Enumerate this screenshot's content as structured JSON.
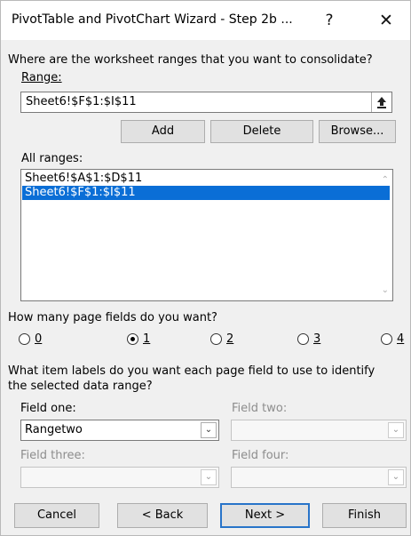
{
  "window": {
    "title": "PivotTable and PivotChart Wizard - Step 2b ...",
    "help_glyph": "?",
    "close_glyph": "✕"
  },
  "ranges_question": "Where are the worksheet ranges that you want to consolidate?",
  "range_label": "Range:",
  "range_value": "Sheet6!$F$1:$I$11",
  "buttons": {
    "add": "Add",
    "delete": "Delete",
    "browse": "Browse..."
  },
  "all_ranges_label": "All ranges:",
  "all_ranges": [
    "Sheet6!$A$1:$D$11",
    "Sheet6!$F$1:$I$11"
  ],
  "selected_range": "Sheet6!$F$1:$I$11",
  "page_fields_question": "How many page fields do you want?",
  "page_field_options": [
    "0",
    "1",
    "2",
    "3",
    "4"
  ],
  "page_field_selected": "1",
  "item_labels_question_line1": "What item labels do you want each page field to use to identify",
  "item_labels_question_line2": "the selected data range?",
  "fields": {
    "one_label": "Field one:",
    "one_value": "Rangetwo",
    "two_label": "Field two:",
    "three_label": "Field three:",
    "four_label": "Field four:"
  },
  "footer": {
    "cancel": "Cancel",
    "back": "< Back",
    "next": "Next >",
    "finish": "Finish"
  },
  "colors": {
    "selection": "#0a6ed6",
    "default_button_border": "#2874c9"
  }
}
